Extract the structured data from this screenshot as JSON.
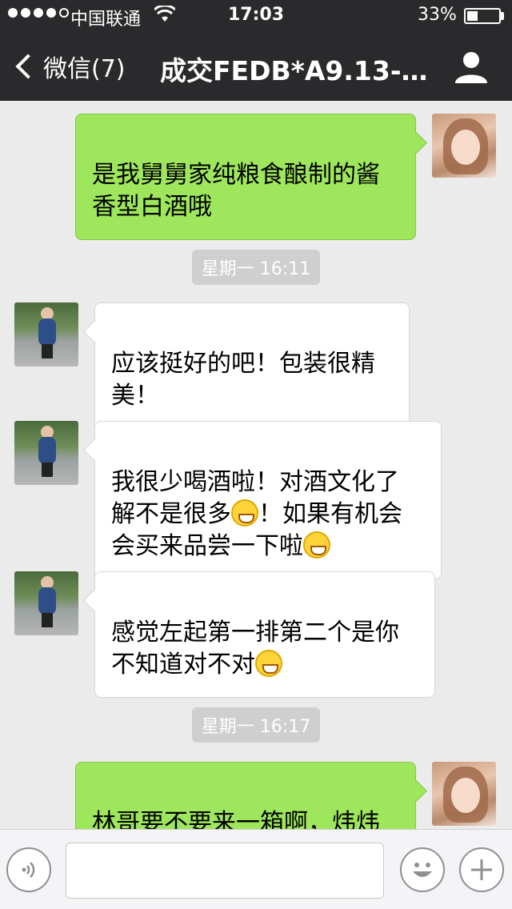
{
  "status_bar": {
    "carrier": "中国联通",
    "time": "17:03",
    "battery_percent": "33%",
    "battery_level": 0.33,
    "signal_bars": 4
  },
  "nav": {
    "back_label": "微信(7)",
    "title": "成交FEDB*A9.13-…",
    "profile_icon": "person-icon"
  },
  "messages": [
    {
      "side": "me",
      "text": "是我舅舅家纯粮食酿制的酱\n香型白酒哦"
    },
    {
      "type": "timestamp",
      "text": "星期一 16:11"
    },
    {
      "side": "other",
      "text": "应该挺好的吧！包装很精\n美！"
    },
    {
      "side": "other",
      "text_parts": [
        "我很少喝酒啦！对酒文化了\n解不是很多",
        "！如果有机会\n会买来品尝一下啦",
        ""
      ]
    },
    {
      "side": "other",
      "text_parts": [
        "感觉左起第一排第二个是你\n不知道对不对",
        ""
      ]
    },
    {
      "type": "timestamp",
      "text": "星期一 16:17"
    },
    {
      "side": "me",
      "text": "林哥要不要来一箱啊，炜炜\n朋友内部价哦"
    }
  ],
  "input_bar": {
    "voice_icon": "voice-icon",
    "emoji_icon": "emoji-icon",
    "plus_icon": "plus-icon",
    "text": ""
  },
  "colors": {
    "topbar": "#2a2a2d",
    "chat_bg": "#ebebeb",
    "my_bubble": "#9ee65b",
    "other_bubble": "#ffffff"
  }
}
